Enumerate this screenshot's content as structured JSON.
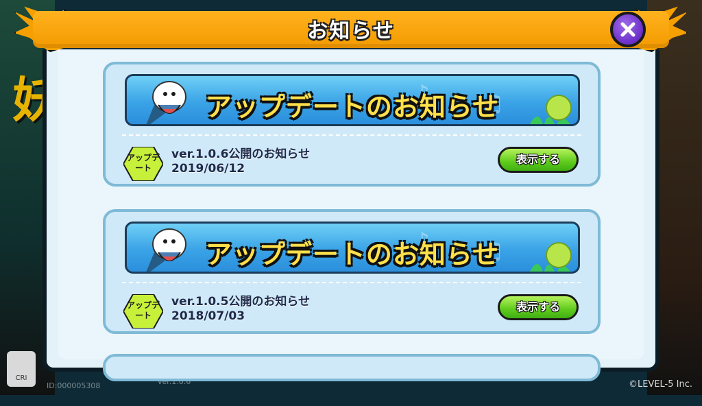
{
  "header": {
    "title": "お知らせ"
  },
  "background": {
    "side_text": "妖",
    "crie_label": "CRI",
    "id_label": "ID:000005308",
    "version_label": "ver.1.0.6",
    "copyright": "©LEVEL-5 Inc."
  },
  "notices": [
    {
      "banner": "アップデートのお知らせ",
      "badge": "アップデート",
      "title": "ver.1.0.6公開のお知らせ",
      "date": "2019/06/12",
      "button": "表示する"
    },
    {
      "banner": "アップデートのお知らせ",
      "badge": "アップデート",
      "title": "ver.1.0.5公開のお知らせ",
      "date": "2018/07/03",
      "button": "表示する"
    }
  ],
  "colors": {
    "header": "#f39a00",
    "banner_text": "#ffe04a",
    "button": "#5fcb1c",
    "close": "#6a2fc8"
  },
  "icons": {
    "close": "close-icon",
    "ghost": "whisper-ghost-icon",
    "badge": "update-badge-icon"
  }
}
